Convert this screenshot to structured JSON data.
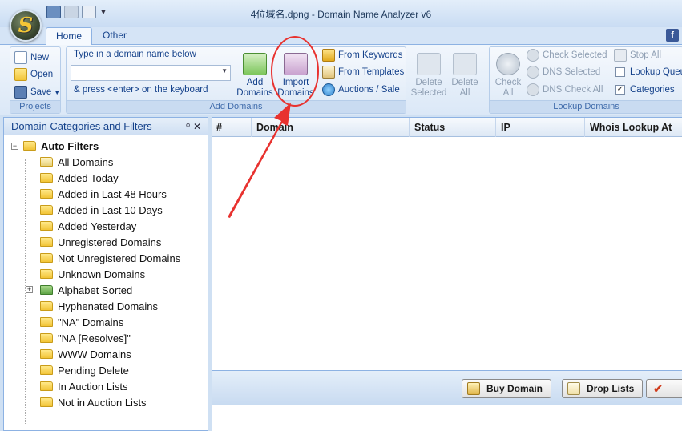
{
  "window": {
    "title": "4位域名.dpng - Domain Name Analyzer v6"
  },
  "app_menu": {
    "logo_letter": "S"
  },
  "ribbon_tabs": [
    {
      "label": "Home"
    },
    {
      "label": "Other"
    }
  ],
  "help_icon_letter": "f",
  "projects": {
    "label": "Projects",
    "new_label": "New",
    "open_label": "Open",
    "save_label": "Save"
  },
  "add_domains": {
    "label": "Add Domains",
    "hint_top": "Type in a domain name below",
    "hint_bottom": "& press <enter> on the keyboard",
    "input_value": "",
    "add_button": "Add Domains",
    "import_button": "Import Domains",
    "from_keywords": "From Keywords",
    "from_templates": "From Templates",
    "auctions_sale": "Auctions / Sale",
    "delete_selected": "Delete Selected",
    "delete_all": "Delete All"
  },
  "lookup_domains": {
    "label": "Lookup Domains",
    "check_all": "Check All",
    "check_selected": "Check Selected",
    "dns_selected": "DNS Selected",
    "dns_check_all": "DNS Check All",
    "stop_all": "Stop All",
    "lookup_queue": "Lookup Queu",
    "categories": "Categories",
    "lookup_queue_checked": false,
    "categories_checked": true
  },
  "left_panel": {
    "title": "Domain Categories and Filters",
    "root": "Auto Filters",
    "items": [
      {
        "label": "All Domains",
        "type": "doc"
      },
      {
        "label": "Added Today",
        "type": "folder"
      },
      {
        "label": "Added in Last 48 Hours",
        "type": "folder"
      },
      {
        "label": "Added in Last 10 Days",
        "type": "folder"
      },
      {
        "label": "Added Yesterday",
        "type": "folder"
      },
      {
        "label": "Unregistered Domains",
        "type": "folder"
      },
      {
        "label": "Not Unregistered Domains",
        "type": "folder"
      },
      {
        "label": "Unknown Domains",
        "type": "folder"
      },
      {
        "label": "Alphabet Sorted",
        "type": "green"
      },
      {
        "label": "Hyphenated Domains",
        "type": "folder"
      },
      {
        "label": "\"NA\" Domains",
        "type": "folder"
      },
      {
        "label": "\"NA [Resolves]\"",
        "type": "folder"
      },
      {
        "label": "WWW Domains",
        "type": "folder"
      },
      {
        "label": "Pending Delete",
        "type": "folder"
      },
      {
        "label": "In Auction Lists",
        "type": "folder"
      },
      {
        "label": "Not in Auction Lists",
        "type": "folder"
      }
    ]
  },
  "grid": {
    "columns": [
      "#",
      "Domain",
      "Status",
      "IP",
      "Whois Lookup At"
    ]
  },
  "bottom_bar": {
    "buy_domain": "Buy Domain",
    "drop_lists": "Drop Lists"
  },
  "annotation": {
    "color": "#e8322f"
  }
}
